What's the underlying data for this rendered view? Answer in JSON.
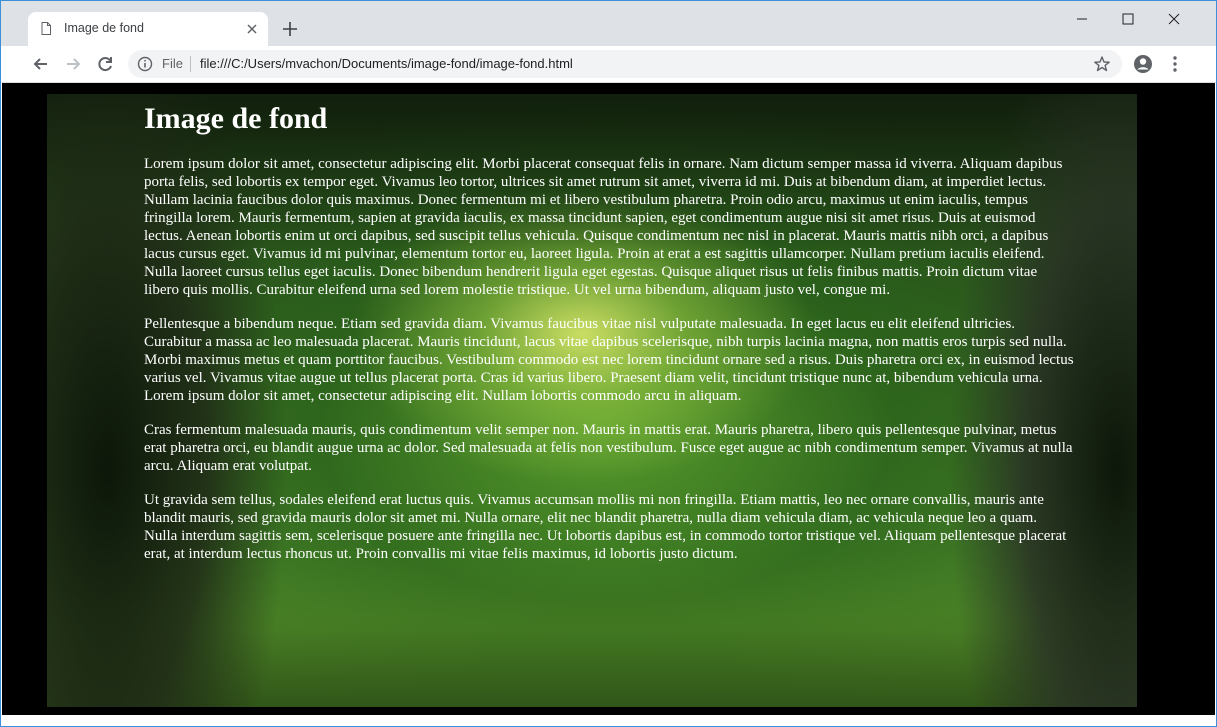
{
  "browser": {
    "tab": {
      "title": "Image de fond"
    },
    "address_bar": {
      "scheme_label": "File",
      "url": "file:///C:/Users/mvachon/Documents/image-fond/image-fond.html"
    }
  },
  "page": {
    "heading": "Image de fond",
    "paragraphs": [
      "Lorem ipsum dolor sit amet, consectetur adipiscing elit. Morbi placerat consequat felis in ornare. Nam dictum semper massa id viverra. Aliquam dapibus porta felis, sed lobortis ex tempor eget. Vivamus leo tortor, ultrices sit amet rutrum sit amet, viverra id mi. Duis at bibendum diam, at imperdiet lectus. Nullam lacinia faucibus dolor quis maximus. Donec fermentum mi et libero vestibulum pharetra. Proin odio arcu, maximus ut enim iaculis, tempus fringilla lorem. Mauris fermentum, sapien at gravida iaculis, ex massa tincidunt sapien, eget condimentum augue nisi sit amet risus. Duis at euismod lectus. Aenean lobortis enim ut orci dapibus, sed suscipit tellus vehicula. Quisque condimentum nec nisl in placerat. Mauris mattis nibh orci, a dapibus lacus cursus eget. Vivamus id mi pulvinar, elementum tortor eu, laoreet ligula. Proin at erat a est sagittis ullamcorper. Nullam pretium iaculis eleifend. Nulla laoreet cursus tellus eget iaculis. Donec bibendum hendrerit ligula eget egestas. Quisque aliquet risus ut felis finibus mattis. Proin dictum vitae libero quis mollis. Curabitur eleifend urna sed lorem molestie tristique. Ut vel urna bibendum, aliquam justo vel, congue mi.",
      "Pellentesque a bibendum neque. Etiam sed gravida diam. Vivamus faucibus vitae nisl vulputate malesuada. In eget lacus eu elit eleifend ultricies. Curabitur a massa ac leo malesuada placerat. Mauris tincidunt, lacus vitae dapibus scelerisque, nibh turpis lacinia magna, non mattis eros turpis sed nulla. Morbi maximus metus et quam porttitor faucibus. Vestibulum commodo est nec lorem tincidunt ornare sed a risus. Duis pharetra orci ex, in euismod lectus varius vel. Vivamus vitae augue ut tellus placerat porta. Cras id varius libero. Praesent diam velit, tincidunt tristique nunc at, bibendum vehicula urna. Lorem ipsum dolor sit amet, consectetur adipiscing elit. Nullam lobortis commodo arcu in aliquam.",
      "Cras fermentum malesuada mauris, quis condimentum velit semper non. Mauris in mattis erat. Mauris pharetra, libero quis pellentesque pulvinar, metus erat pharetra orci, eu blandit augue urna ac dolor. Sed malesuada at felis non vestibulum. Fusce eget augue ac nibh condimentum semper. Vivamus at nulla arcu. Aliquam erat volutpat.",
      "Ut gravida sem tellus, sodales eleifend erat luctus quis. Vivamus accumsan mollis mi non fringilla. Etiam mattis, leo nec ornare convallis, mauris ante blandit mauris, sed gravida mauris dolor sit amet mi. Nulla ornare, elit nec blandit pharetra, nulla diam vehicula diam, ac vehicula neque leo a quam. Nulla interdum sagittis sem, scelerisque posuere ante fringilla nec. Ut lobortis dapibus est, in commodo tortor tristique vel. Aliquam pellentesque placerat erat, at interdum lectus rhoncus ut. Proin convallis mi vitae felis maximus, id lobortis justo dictum."
    ]
  },
  "icons": {
    "tab": "page-icon",
    "tab_close": "close-icon",
    "new_tab": "plus-icon",
    "minimize": "minimize-icon",
    "maximize": "maximize-icon",
    "close_window": "close-icon",
    "back": "arrow-left-icon",
    "forward": "arrow-right-icon",
    "reload": "reload-icon",
    "info": "info-icon",
    "bookmark": "star-icon",
    "profile": "account-icon",
    "menu": "more-vert-icon"
  },
  "colors": {
    "tab_strip": "#dee1e6",
    "window_border": "#3c8fd8",
    "page_background": "#000000",
    "text": "#ffffff"
  }
}
